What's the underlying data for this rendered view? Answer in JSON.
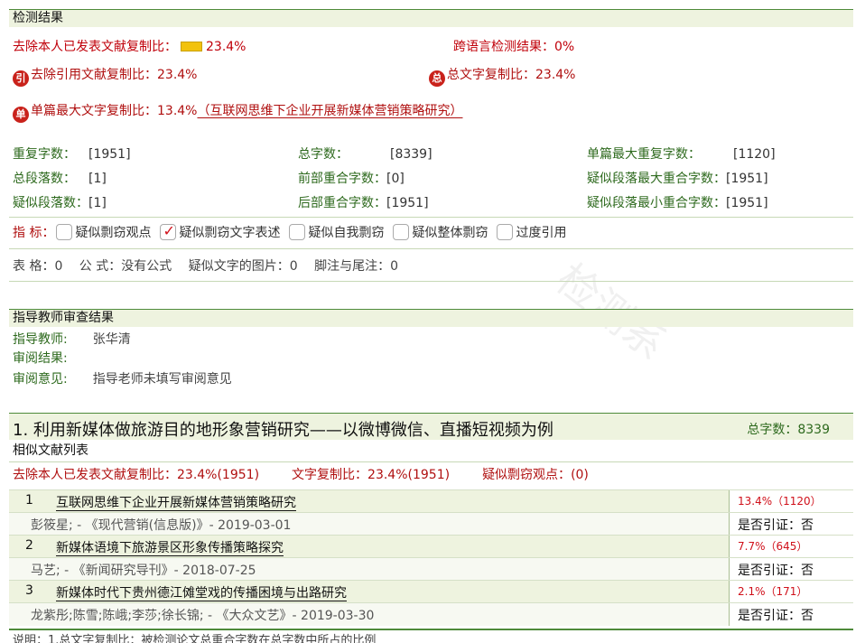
{
  "result_header": "检测结果",
  "summary": {
    "excl_self_label": "去除本人已发表文献复制比：",
    "excl_self_value": "23.4%",
    "cross_lang_label": "跨语言检测结果：",
    "cross_lang_value": "0%",
    "excl_cite_badge": "引",
    "excl_cite_label": "去除引用文献复制比：",
    "excl_cite_value": "23.4%",
    "total_badge": "总",
    "total_label": "总文字复制比：",
    "total_value": "23.4%",
    "single_badge": "单",
    "single_label": "单篇最大文字复制比：",
    "single_value": "13.4%",
    "single_doc": "（互联网思维下企业开展新媒体营销策略研究）"
  },
  "stats": [
    [
      {
        "label": "重复字数：",
        "value": "[1951]"
      },
      {
        "label": "总字数：",
        "value": "[8339]"
      },
      {
        "label": "单篇最大重复字数：",
        "value": "[1120]"
      }
    ],
    [
      {
        "label": "总段落数：",
        "value": "[1]"
      },
      {
        "label": "前部重合字数：",
        "value": "[0]"
      },
      {
        "label": "疑似段落最大重合字数：",
        "value": "[1951]"
      }
    ],
    [
      {
        "label": "疑似段落数：",
        "value": "[1]"
      },
      {
        "label": "后部重合字数：",
        "value": "[1951]"
      },
      {
        "label": "疑似段落最小重合字数：",
        "value": "[1951]"
      }
    ]
  ],
  "indicators": {
    "label": "指 标：",
    "items": [
      {
        "label": "疑似剽窃观点",
        "checked": false
      },
      {
        "label": "疑似剽窃文字表述",
        "checked": true
      },
      {
        "label": "疑似自我剽窃",
        "checked": false
      },
      {
        "label": "疑似整体剽窃",
        "checked": false
      },
      {
        "label": "过度引用",
        "checked": false
      }
    ]
  },
  "misc": "表 格：0　 公 式：没有公式　 疑似文字的图片：0　 脚注与尾注：0",
  "teacher": {
    "header": "指导教师审查结果",
    "name_label": "指导教师:",
    "name_value": "张华清",
    "result_label": "审阅结果:",
    "opinion_label": "审阅意见:",
    "opinion_value": "指导老师未填写审阅意见"
  },
  "section": {
    "title": "1. 利用新媒体做旅游目的地形象营销研究——以微博微信、直播短视频为例",
    "total_chars": "总字数：8339",
    "list_header": "相似文献列表",
    "excl_label": "去除本人已发表文献复制比：",
    "excl_value": "23.4%(1951)",
    "copy_label": "文字复制比：",
    "copy_value": "23.4%(1951)",
    "susp_label": "疑似剽窃观点：",
    "susp_value": "(0)"
  },
  "sources": [
    {
      "num": "1",
      "title": "互联网思维下企业开展新媒体营销策略研究",
      "pct": "13.4%（1120）",
      "meta": "彭筱星; - 《现代营销(信息版)》- 2019-03-01",
      "cite": "是否引证：否"
    },
    {
      "num": "2",
      "title": "新媒体语境下旅游景区形象传播策略探究",
      "pct": "7.7%（645）",
      "meta": "马艺; - 《新闻研究导刊》- 2018-07-25",
      "cite": "是否引证：否"
    },
    {
      "num": "3",
      "title": "新媒体时代下贵州德江傩堂戏的传播困境与出路研究",
      "pct": "2.1%（171）",
      "meta": "龙紫彤;陈雪;陈峨;李莎;徐长锦; - 《大众文艺》- 2019-03-30",
      "cite": "是否引证：否"
    }
  ],
  "footer": "说明：1.总文字复制比：被检测论文总重合字数在总字数中所占的比例"
}
